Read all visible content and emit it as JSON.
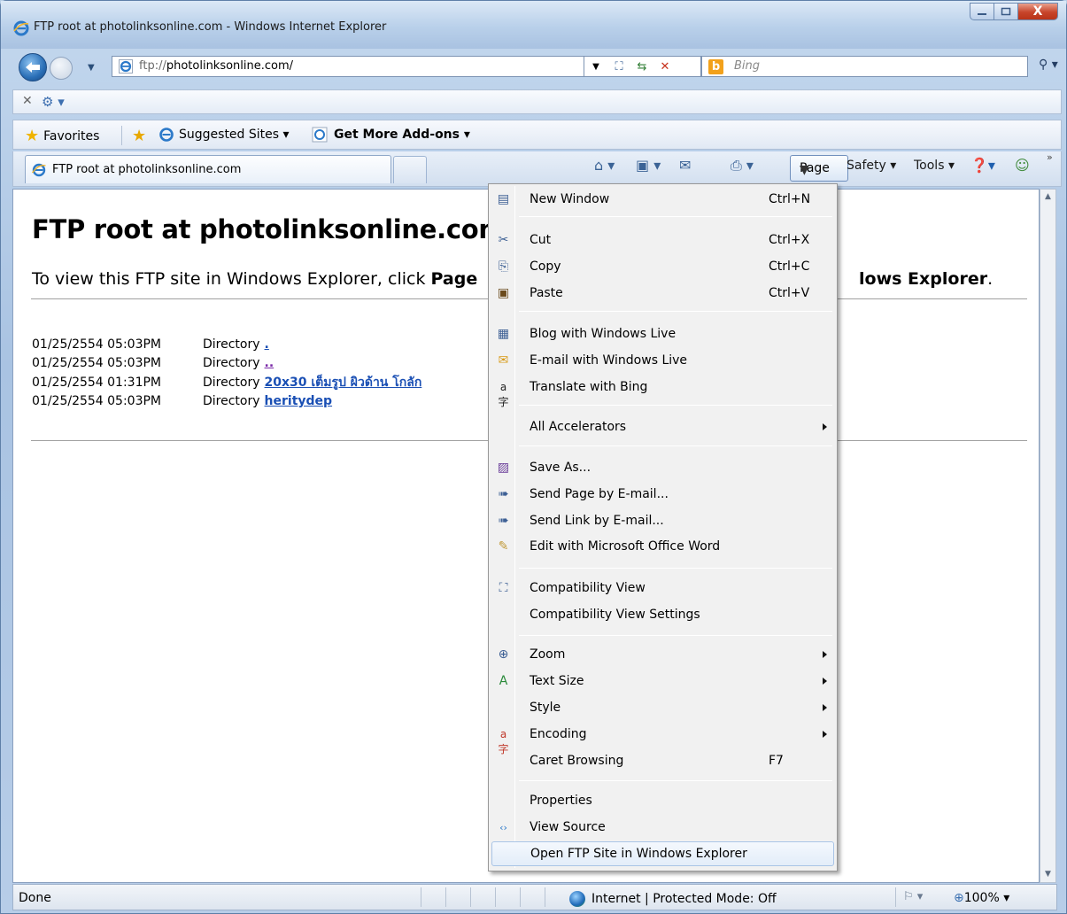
{
  "window": {
    "title": "FTP root at photolinksonline.com - Windows Internet Explorer",
    "close_glyph": "X"
  },
  "address": {
    "url_prefix": "ftp://",
    "url_host": "photolinksonline.com/"
  },
  "search": {
    "logo_text": "b",
    "placeholder": "Bing"
  },
  "favorites_bar": {
    "favorites": "Favorites",
    "suggested_sites": "Suggested Sites ▾",
    "get_addons": "Get More Add-ons ▾"
  },
  "tab": {
    "label": "FTP root at photolinksonline.com"
  },
  "command_bar": {
    "page": "Page",
    "safety": "Safety ▾",
    "tools": "Tools ▾"
  },
  "content": {
    "heading": "FTP root at photolinksonline.com",
    "instruction_start": "To view this FTP site in Windows Explorer, click ",
    "instruction_bold": "Page",
    "instruction_tail": "lows Explorer",
    "instruction_end": ".",
    "listing": [
      {
        "date": "01/25/2554 05:03PM",
        "kind": "Directory",
        "name": "."
      },
      {
        "date": "01/25/2554 05:03PM",
        "kind": "Directory",
        "name": ".."
      },
      {
        "date": "01/25/2554 01:31PM",
        "kind": "Directory",
        "name": "20x30 เต็มรูป ผิวด้าน โกลัก"
      },
      {
        "date": "01/25/2554 05:03PM",
        "kind": "Directory",
        "name": "heritydep"
      }
    ]
  },
  "menu": {
    "items": [
      {
        "label": "New Window",
        "shortcut": "Ctrl+N",
        "icon": "new-window-icon"
      },
      {
        "label": "Cut",
        "shortcut": "Ctrl+X",
        "icon": "scissors-icon"
      },
      {
        "label": "Copy",
        "shortcut": "Ctrl+C",
        "icon": "copy-icon"
      },
      {
        "label": "Paste",
        "shortcut": "Ctrl+V",
        "icon": "paste-icon"
      },
      {
        "label": "Blog with Windows Live",
        "shortcut": "",
        "icon": "blog-icon"
      },
      {
        "label": "E-mail with Windows Live",
        "shortcut": "",
        "icon": "email-live-icon"
      },
      {
        "label": "Translate with Bing",
        "shortcut": "",
        "icon": "translate-icon"
      },
      {
        "label": "All Accelerators",
        "shortcut": "",
        "icon": ""
      },
      {
        "label": "Save As...",
        "shortcut": "",
        "icon": "save-icon"
      },
      {
        "label": "Send Page by E-mail...",
        "shortcut": "",
        "icon": "send-page-icon"
      },
      {
        "label": "Send Link by E-mail...",
        "shortcut": "",
        "icon": "send-link-icon"
      },
      {
        "label": "Edit with Microsoft Office Word",
        "shortcut": "",
        "icon": "pencil-icon"
      },
      {
        "label": "Compatibility View",
        "shortcut": "",
        "icon": "compatibility-icon"
      },
      {
        "label": "Compatibility View Settings",
        "shortcut": "",
        "icon": ""
      },
      {
        "label": "Zoom",
        "shortcut": "",
        "icon": "zoom-icon"
      },
      {
        "label": "Text Size",
        "shortcut": "",
        "icon": "text-size-icon"
      },
      {
        "label": "Style",
        "shortcut": "",
        "icon": ""
      },
      {
        "label": "Encoding",
        "shortcut": "",
        "icon": "encoding-icon"
      },
      {
        "label": "Caret Browsing",
        "shortcut": "F7",
        "icon": ""
      },
      {
        "label": "Properties",
        "shortcut": "",
        "icon": ""
      },
      {
        "label": "View Source",
        "shortcut": "",
        "icon": "view-source-icon"
      },
      {
        "label": "Open FTP Site in Windows Explorer",
        "shortcut": "",
        "icon": ""
      }
    ]
  },
  "status": {
    "left": "Done",
    "zone": "Internet | Protected Mode: Off",
    "zoom": "100%"
  }
}
